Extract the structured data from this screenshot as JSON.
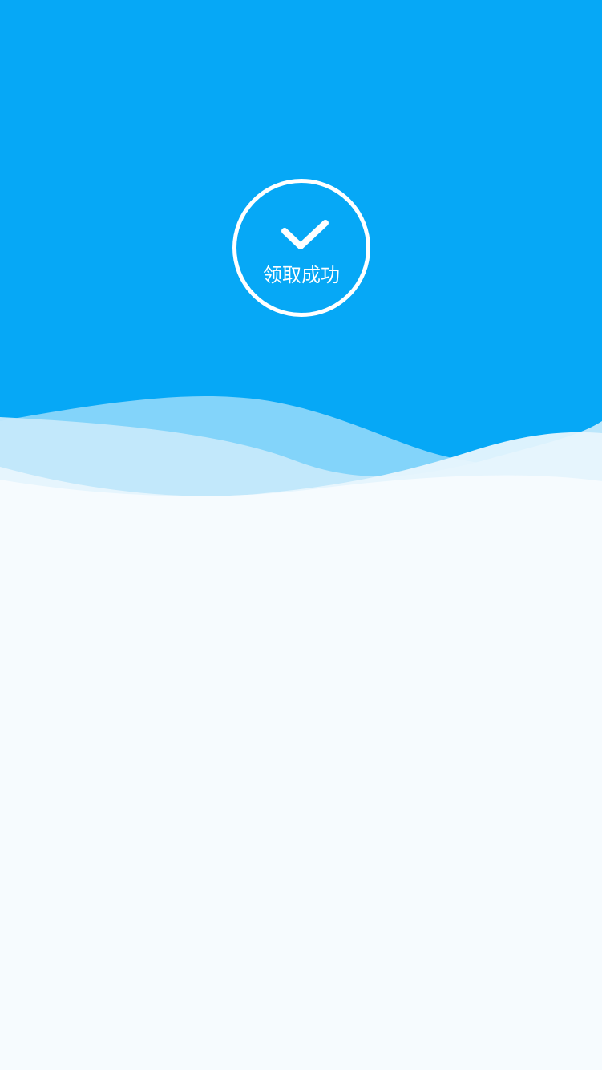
{
  "status": {
    "label": "领取成功",
    "icon": "check-icon"
  },
  "colors": {
    "header_blue": "#06A8F6",
    "background": "#F6FBFE",
    "wave_light": "#BFE7FB",
    "wave_mid": "#8AD6FA"
  }
}
